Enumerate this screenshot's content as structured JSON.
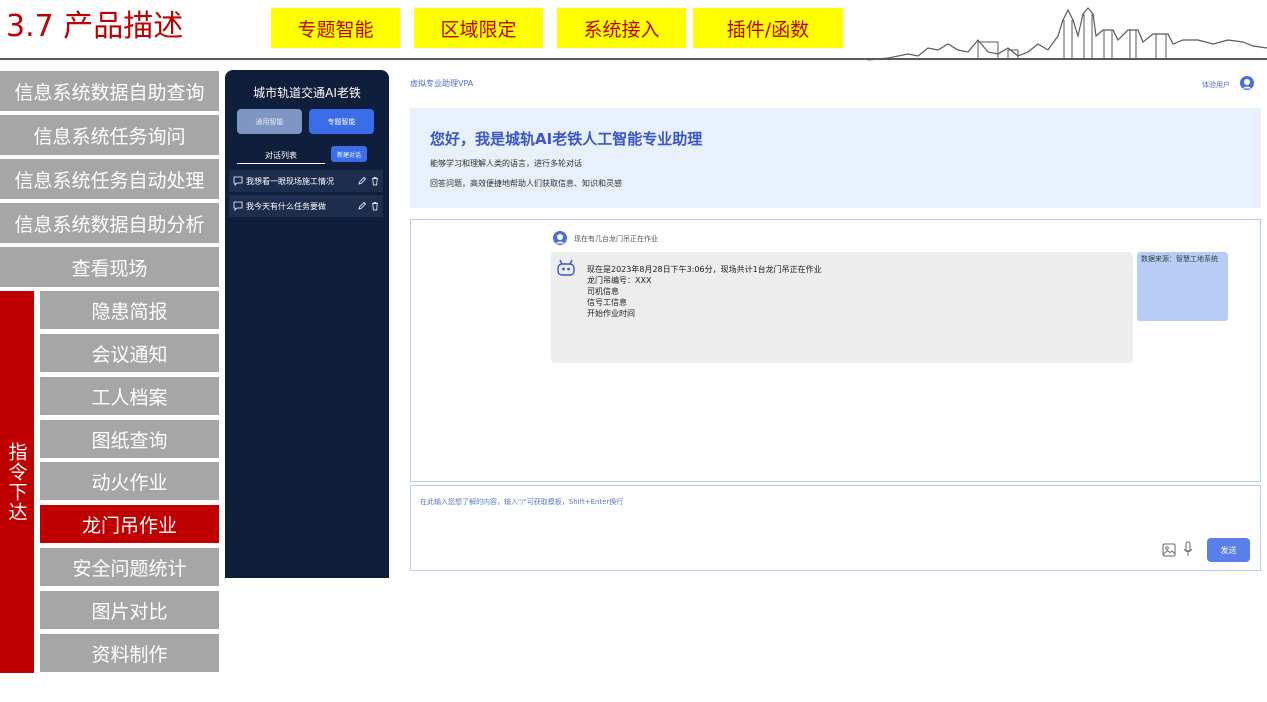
{
  "slide": {
    "title": "3.7 产品描述",
    "tags": [
      "专题智能",
      "区域限定",
      "系统接入",
      "插件/函数"
    ]
  },
  "left_menu": {
    "top_items": [
      "信息系统数据自助查询",
      "信息系统任务询问",
      "信息系统任务自动处理",
      "信息系统数据自助分析",
      "查看现场"
    ],
    "command_label": "指令下达",
    "sub_items": [
      "隐患简报",
      "会议通知",
      "工人档案",
      "图纸查询",
      "动火作业",
      "龙门吊作业",
      "安全问题统计",
      "图片对比",
      "资料制作"
    ],
    "active_sub": "龙门吊作业"
  },
  "sidebar": {
    "title": "城市轨道交通AI老铁",
    "mode_general": "通用智能",
    "mode_special": "专题智能",
    "list_label": "对话列表",
    "new_chat": "新建对话",
    "conversations": [
      "我想看一眼现场施工情况",
      "我今天有什么任务要做"
    ]
  },
  "header": {
    "app_name": "虚拟专业助理VPA",
    "user": "体验用户"
  },
  "welcome": {
    "heading": "您好，我是城轨AI老铁人工智能专业助理",
    "line1": "能够学习和理解人类的语言，进行多轮对话",
    "line2": "回答问题，高效便捷地帮助人们获取信息、知识和灵感"
  },
  "chat": {
    "question": "现在有几台龙门吊正在作业",
    "answer_lines": [
      "现在是2023年8月28日下午3:06分，现场共计1台龙门吊正在作业",
      "龙门吊编号：XXX",
      "司机信息",
      "信号工信息",
      "开始作业时间"
    ],
    "source": "数据来源：智慧工地系统"
  },
  "input": {
    "placeholder": "在此输入您想了解的内容，输入\"/\"可获取模板，Shift+Enter换行",
    "send": "发送"
  },
  "colors": {
    "slide_red": "#c00000",
    "tag_yellow": "#ffff00",
    "menu_gray": "#a6a6a6",
    "sidebar_navy": "#0f1e3a",
    "accent_blue": "#3b6de8"
  }
}
